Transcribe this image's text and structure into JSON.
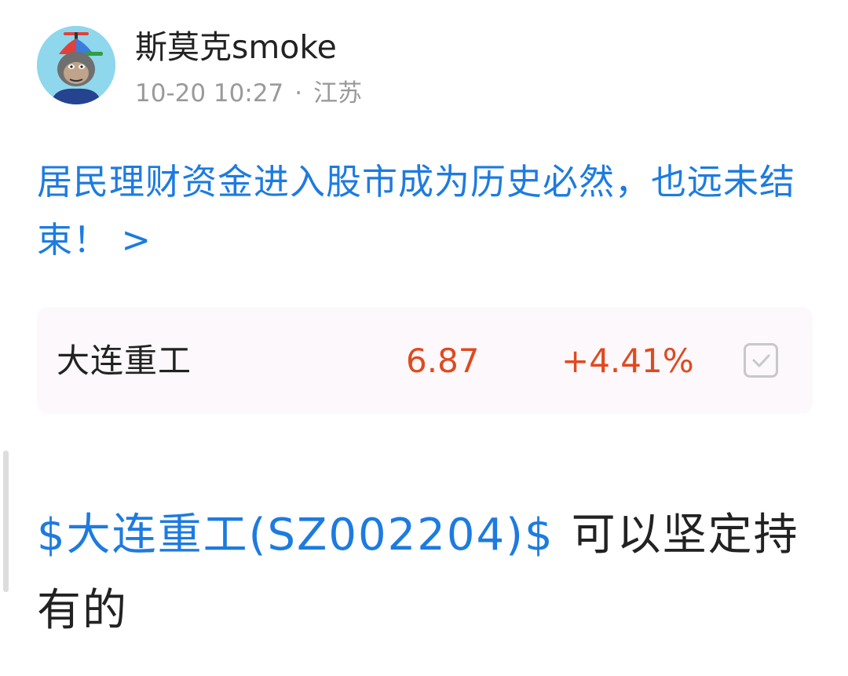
{
  "post": {
    "author": "斯莫克smoke",
    "timestamp": "10-20 10:27",
    "separator": "·",
    "location": "江苏",
    "avatar_icon": "ape-avatar-icon"
  },
  "article": {
    "title": "居民理财资金进入股市成为历史必然，也远未结束！",
    "arrow": ">"
  },
  "stock": {
    "name": "大连重工",
    "price": "6.87",
    "change": "+4.41%",
    "checked": true,
    "change_color": "#df4a1f"
  },
  "content": {
    "stock_tag": "$大连重工(SZ002204)$",
    "text": "可以坚定持有的"
  },
  "colors": {
    "link": "#1d7be0",
    "up": "#df4a1f",
    "meta": "#9a9a9a"
  }
}
